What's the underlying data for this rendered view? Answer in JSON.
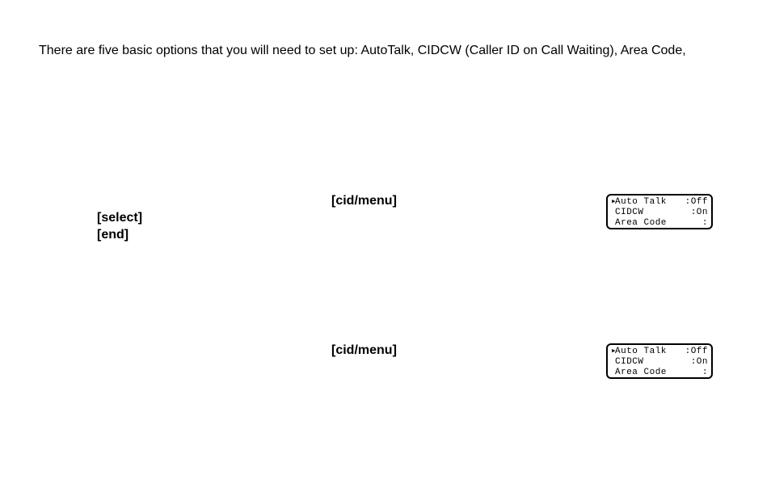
{
  "intro": "There are five basic options that you will need to set up: AutoTalk, CIDCW (Caller ID on Call Waiting), Area Code,",
  "section1": {
    "cidmenu": "[cid/menu]",
    "select": "[select]",
    "end": "[end]",
    "display": {
      "cursor": "▸",
      "row1_label": "Auto Talk",
      "row1_value": ":Off",
      "row2_label": "CIDCW",
      "row2_value": ":On",
      "row3_label": "Area Code",
      "row3_value": ":"
    }
  },
  "section2": {
    "cidmenu": "[cid/menu]",
    "display": {
      "cursor": "▸",
      "row1_label": "Auto Talk",
      "row1_value": ":Off",
      "row2_label": "CIDCW",
      "row2_value": ":On",
      "row3_label": "Area Code",
      "row3_value": ":"
    }
  }
}
